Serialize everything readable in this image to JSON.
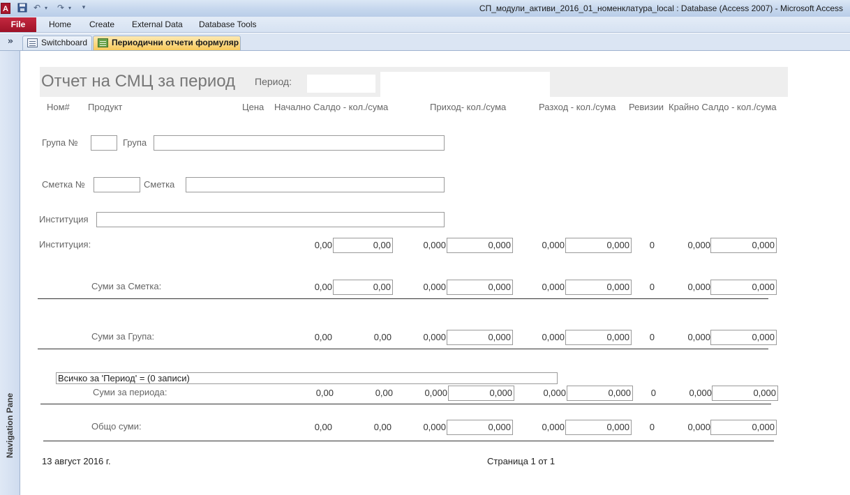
{
  "titlebar": {
    "app_icon": "A",
    "save_icon": "save-icon",
    "undo_icon": "undo-icon",
    "redo_icon": "redo-icon",
    "customize_icon": "customize-qat-icon",
    "title": "СП_модули_активи_2016_01_номенклатура_local : Database (Access 2007)  -  Microsoft Access"
  },
  "ribbon": {
    "file": "File",
    "tabs": [
      "Home",
      "Create",
      "External Data",
      "Database Tools"
    ]
  },
  "doc_tabs": {
    "collapse_glyph": "»",
    "items": [
      {
        "label": "Switchboard",
        "icon": "form-icon"
      },
      {
        "label": "Периодични отчети формуляр",
        "icon": "report-icon"
      }
    ]
  },
  "nav_pane": {
    "label": "Navigation Pane"
  },
  "report": {
    "title": "Отчет на СМЦ за период",
    "period_label": "Период:",
    "columns": {
      "num": "Ном#",
      "product": "Продукт",
      "price": "Цена",
      "opening": "Начално Салдо - кол./сума",
      "income": "Приход- кол./сума",
      "expense": "Разход - кол./сума",
      "revisions": "Ревизии",
      "closing": "Крайно Салдо - кол./сума"
    },
    "group_no_label": "Група №",
    "group_label": "Група",
    "account_no_label": "Сметка №",
    "account_label": "Сметка",
    "institution_label": "Институция",
    "rows": {
      "institution": {
        "label": "Институция:",
        "opening_qty": "0,00",
        "opening_sum": "0,00",
        "income_qty": "0,000",
        "income_sum": "0,000",
        "expense_qty": "0,000",
        "expense_sum": "0,000",
        "revisions": "0",
        "closing_qty": "0,000",
        "closing_sum": "0,000"
      },
      "account": {
        "label": "Суми за Сметка:",
        "opening_qty": "0,00",
        "opening_sum": "0,00",
        "income_qty": "0,000",
        "income_sum": "0,000",
        "expense_qty": "0,000",
        "expense_sum": "0,000",
        "revisions": "0",
        "closing_qty": "0,000",
        "closing_sum": "0,000"
      },
      "group": {
        "label": "Суми за Група:",
        "opening_qty": "0,00",
        "opening_sum": "0,00",
        "income_qty": "0,000",
        "income_sum": "0,000",
        "expense_qty": "0,000",
        "expense_sum": "0,000",
        "revisions": "0",
        "closing_qty": "0,000",
        "closing_sum": "0,000"
      },
      "period": {
        "label": "Суми за периода:",
        "opening_qty": "0,00",
        "opening_sum": "0,00",
        "income_qty": "0,000",
        "income_sum": "0,000",
        "expense_qty": "0,000",
        "expense_sum": "0,000",
        "revisions": "0",
        "closing_qty": "0,000",
        "closing_sum": "0,000"
      },
      "total": {
        "label": "Общо суми:",
        "opening_qty": "0,00",
        "opening_sum": "0,00",
        "income_qty": "0,000",
        "income_sum": "0,000",
        "expense_qty": "0,000",
        "expense_sum": "0,000",
        "revisions": "0",
        "closing_qty": "0,000",
        "closing_sum": "0,000"
      }
    },
    "summary_text": "Всичко за 'Период' =   (0 записи)",
    "footer_date": "13 август 2016 г.",
    "footer_page": "Страница 1 от 1"
  }
}
